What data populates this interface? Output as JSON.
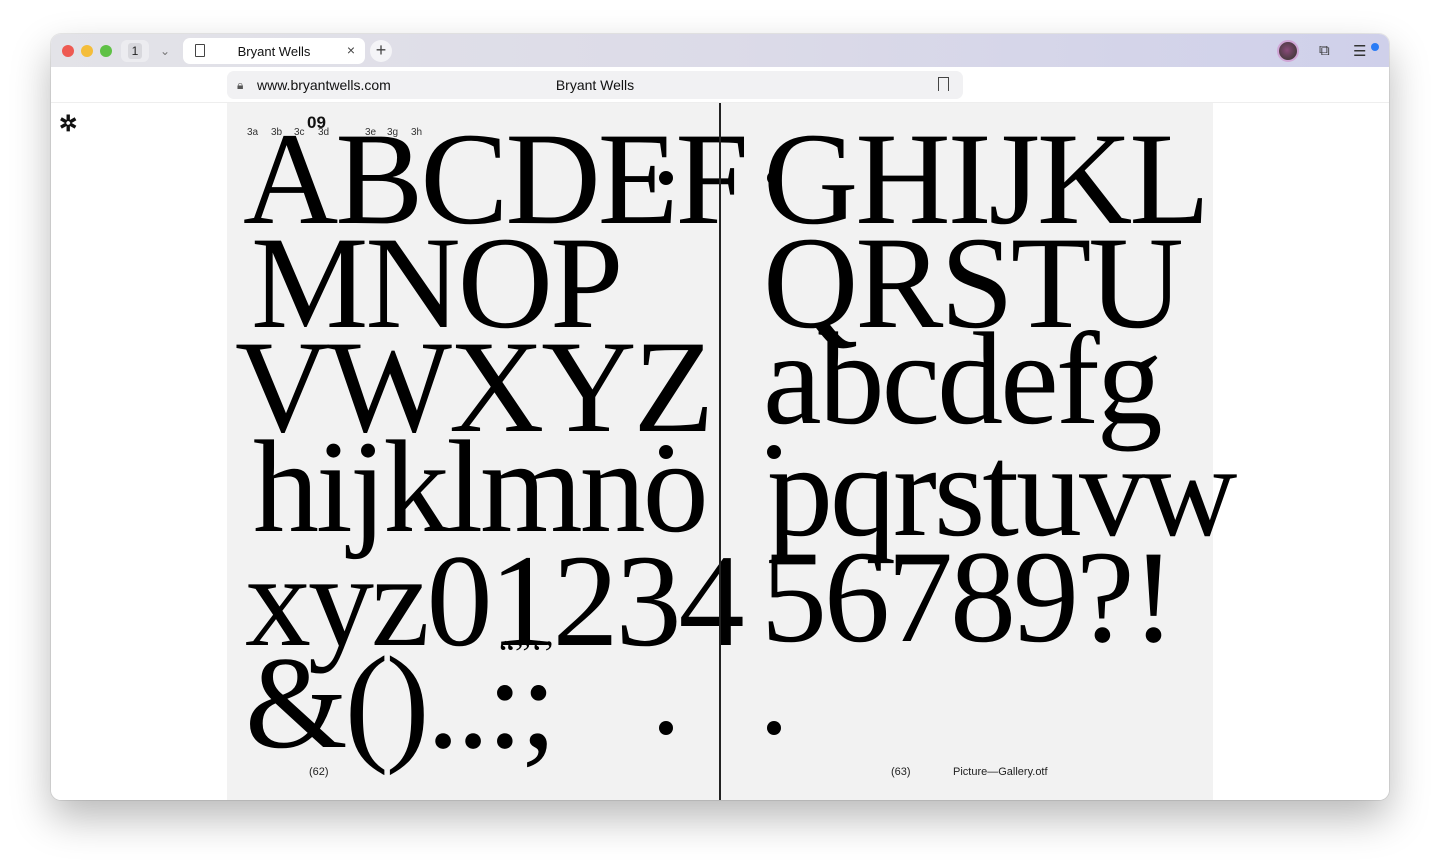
{
  "browser": {
    "tab_count": "1",
    "tab_title": "Bryant Wells",
    "url": "www.bryantwells.com",
    "page_title": "Bryant Wells"
  },
  "page": {
    "logo": "✲",
    "section_number": "09",
    "glyph_labels": [
      "3a",
      "3b",
      "3c",
      "3d",
      "3e",
      "3g",
      "3h"
    ],
    "left_lines": [
      "ABCDEF",
      "MNOP",
      "VWXYZ",
      "hijklmno",
      "xyz01234",
      "&()..:;"
    ],
    "quote_marks": "“”‘’",
    "right_lines": [
      "GHIJKL",
      "QRSTU",
      "abcdefg",
      "pqrstuvw",
      "56789?!"
    ],
    "left_page_number": "(62)",
    "right_page_number": "(63)",
    "font_file": "Picture—Gallery.otf"
  }
}
